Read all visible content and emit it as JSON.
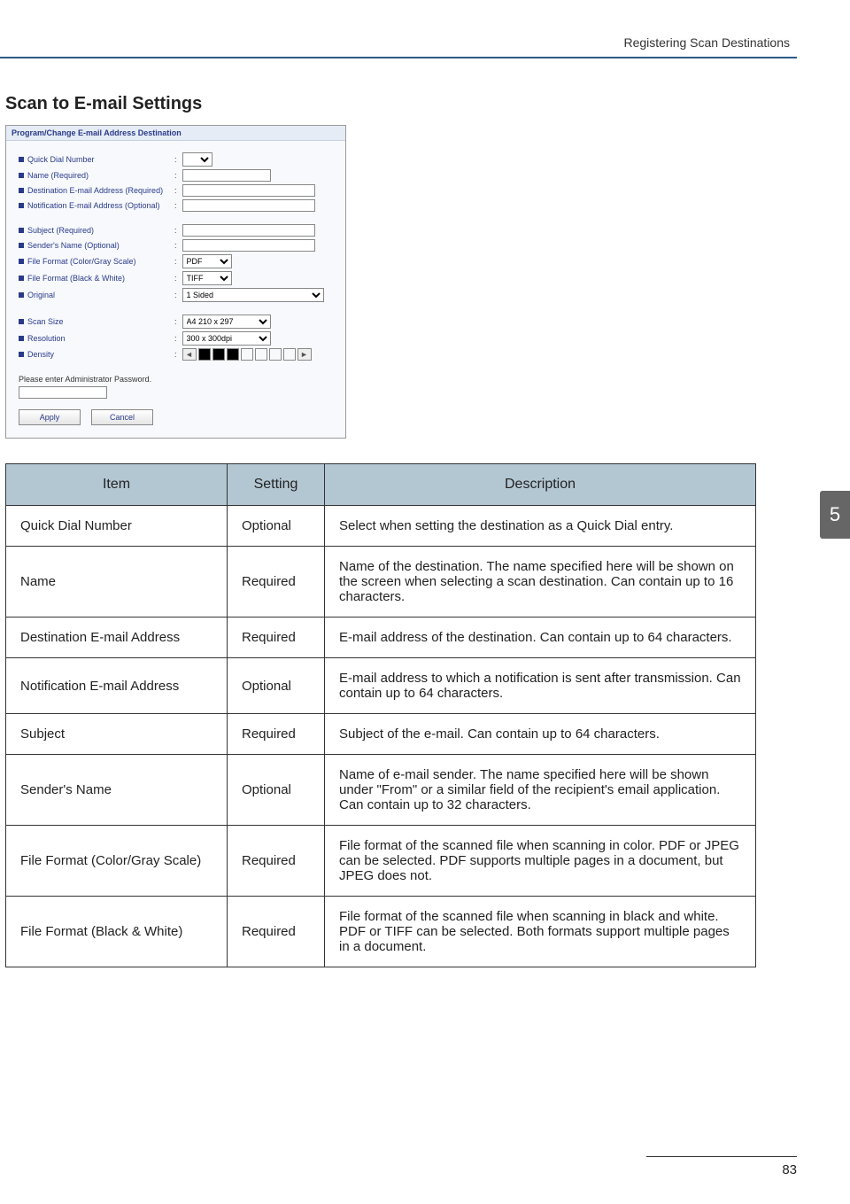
{
  "runhead": "Registering Scan Destinations",
  "section_title": "Scan to E-mail Settings",
  "side_tab": "5",
  "page_number": "83",
  "screenshot": {
    "title": "Program/Change E-mail Address Destination",
    "rows": [
      {
        "label": "Quick Dial Number",
        "ctrl": "select_small",
        "value": ""
      },
      {
        "label": "Name (Required)",
        "ctrl": "text_s",
        "value": ""
      },
      {
        "label": "Destination E-mail Address (Required)",
        "ctrl": "text_m",
        "value": ""
      },
      {
        "label": "Notification E-mail Address (Optional)",
        "ctrl": "text_m",
        "value": ""
      },
      {
        "label": "Subject (Required)",
        "ctrl": "text_m",
        "value": ""
      },
      {
        "label": "Sender's Name (Optional)",
        "ctrl": "text_m",
        "value": ""
      },
      {
        "label": "File Format (Color/Gray Scale)",
        "ctrl": "select",
        "value": "PDF"
      },
      {
        "label": "File Format (Black & White)",
        "ctrl": "select",
        "value": "TIFF"
      },
      {
        "label": "Original",
        "ctrl": "select_wide",
        "value": "1 Sided"
      },
      {
        "label": "Scan Size",
        "ctrl": "select_med",
        "value": "A4 210 x 297"
      },
      {
        "label": "Resolution",
        "ctrl": "select_med",
        "value": "300 x 300dpi"
      },
      {
        "label": "Density",
        "ctrl": "density"
      }
    ],
    "note": "Please enter Administrator Password.",
    "apply": "Apply",
    "cancel": "Cancel"
  },
  "table": {
    "headers": [
      "Item",
      "Setting",
      "Description"
    ],
    "rows": [
      {
        "item": "Quick Dial Number",
        "setting": "Optional",
        "desc": "Select when setting the destination as a Quick Dial entry."
      },
      {
        "item": "Name",
        "setting": "Required",
        "desc": "Name of the destination. The name specified here will be shown on the screen when selecting a scan destination. Can contain up to 16 characters."
      },
      {
        "item": "Destination E-mail Address",
        "setting": "Required",
        "desc": "E-mail address of the destination. Can contain up to 64 characters."
      },
      {
        "item": "Notification E-mail Address",
        "setting": "Optional",
        "desc": "E-mail address to which a notification is sent after transmission. Can contain up to 64 characters."
      },
      {
        "item": "Subject",
        "setting": "Required",
        "desc": "Subject of the e-mail. Can contain up to 64 characters."
      },
      {
        "item": "Sender's Name",
        "setting": "Optional",
        "desc": "Name of e-mail sender. The name specified here will be shown under \"From\" or a similar field of the recipient's email application. Can contain up to 32 characters."
      },
      {
        "item": "File Format (Color/Gray Scale)",
        "setting": "Required",
        "desc": "File format of the scanned file when scanning in color. PDF or JPEG can be selected. PDF supports multiple pages in a document, but JPEG does not."
      },
      {
        "item": "File Format (Black & White)",
        "setting": "Required",
        "desc": "File format of the scanned file when scanning in black and white. PDF or TIFF can be selected. Both formats support multiple pages in a document."
      }
    ]
  }
}
